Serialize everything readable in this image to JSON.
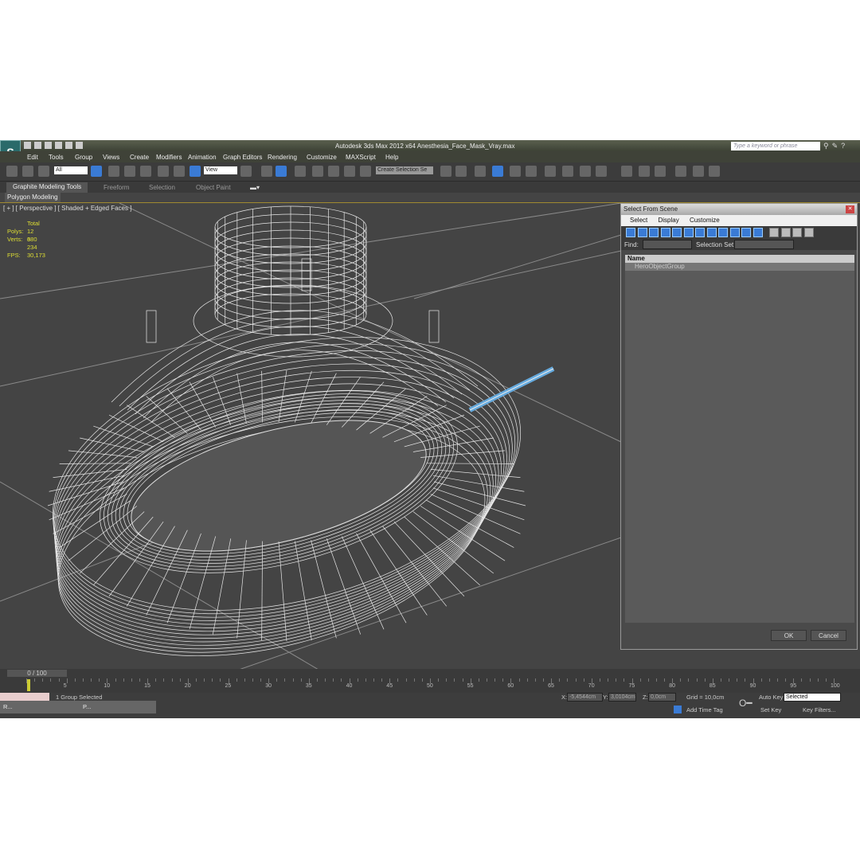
{
  "app": {
    "logo": "S",
    "title": "Autodesk 3ds Max  2012 x64     Anesthesia_Face_Mask_Vray.max",
    "search_placeholder": "Type a keyword or phrase"
  },
  "menu": [
    "Edit",
    "Tools",
    "Group",
    "Views",
    "Create",
    "Modifiers",
    "Animation",
    "Graph Editors",
    "Rendering",
    "Customize",
    "MAXScript",
    "Help"
  ],
  "toolbar": {
    "filter": "All",
    "ref_coord": "View",
    "selection_set": "Create Selection Se"
  },
  "ribbon": {
    "tabs": [
      "Graphite Modeling Tools",
      "Freeform",
      "Selection",
      "Object Paint"
    ],
    "panel": "Polygon Modeling"
  },
  "viewport": {
    "label": "[ + ] [ Perspective ] [ Shaded + Edged Faces ]",
    "stats": {
      "header": "Total",
      "polys_label": "Polys:",
      "polys": "12 380",
      "verts_label": "Verts:",
      "verts": "6 234",
      "fps_label": "FPS:",
      "fps": "30,173"
    }
  },
  "dialog": {
    "title": "Select From Scene",
    "menu": [
      "Select",
      "Display",
      "Customize"
    ],
    "find_label": "Find:",
    "selection_set_label": "Selection Set:",
    "column": "Name",
    "items": [
      "HeroObjectGroup"
    ],
    "ok": "OK",
    "cancel": "Cancel"
  },
  "timeline": {
    "position": "0 / 100",
    "ticks": [
      "5",
      "10",
      "15",
      "20",
      "25",
      "30",
      "35",
      "40",
      "45",
      "50",
      "55",
      "60",
      "65",
      "70",
      "75",
      "80",
      "85",
      "90",
      "95",
      "100"
    ]
  },
  "status": {
    "selected": "1 Group Selected",
    "x_label": "X:",
    "x": "-5,4544cm",
    "y_label": "Y:",
    "y": "3,0104cm",
    "z_label": "Z:",
    "z": "0,0cm",
    "grid": "Grid = 10,0cm",
    "add_time_tag": "Add Time Tag",
    "auto_key": "Auto Key",
    "key_mode": "Selected",
    "set_key": "Set Key",
    "key_filters": "Key Filters...",
    "taskbar": [
      "R...",
      "P..."
    ]
  },
  "colors": {
    "accent": "#3a7bd5",
    "stats": "#dddd33",
    "viewport": "#444444"
  }
}
